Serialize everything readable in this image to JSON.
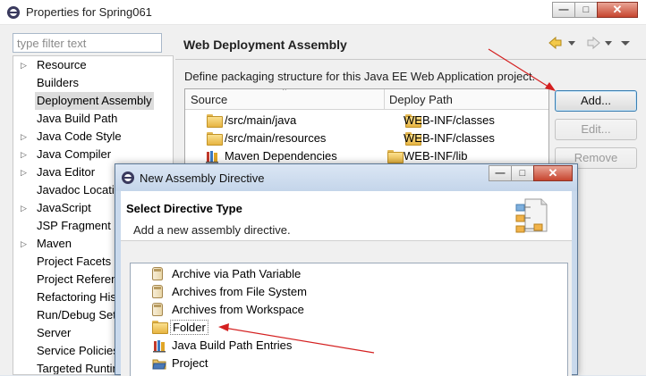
{
  "window": {
    "title": "Properties for Spring061",
    "minimize": "—",
    "maximize": "□",
    "close": "✕"
  },
  "filter": {
    "placeholder": "type filter text"
  },
  "nav": {
    "items": [
      {
        "label": "Resource",
        "expandable": true,
        "selected": false
      },
      {
        "label": "Builders",
        "expandable": false,
        "selected": false
      },
      {
        "label": "Deployment Assembly",
        "expandable": false,
        "selected": true
      },
      {
        "label": "Java Build Path",
        "expandable": false,
        "selected": false
      },
      {
        "label": "Java Code Style",
        "expandable": true,
        "selected": false
      },
      {
        "label": "Java Compiler",
        "expandable": true,
        "selected": false
      },
      {
        "label": "Java Editor",
        "expandable": true,
        "selected": false
      },
      {
        "label": "Javadoc Location",
        "expandable": false,
        "selected": false
      },
      {
        "label": "JavaScript",
        "expandable": true,
        "selected": false
      },
      {
        "label": "JSP Fragment",
        "expandable": false,
        "selected": false
      },
      {
        "label": "Maven",
        "expandable": true,
        "selected": false
      },
      {
        "label": "Project Facets",
        "expandable": false,
        "selected": false
      },
      {
        "label": "Project References",
        "expandable": false,
        "selected": false
      },
      {
        "label": "Refactoring History",
        "expandable": false,
        "selected": false
      },
      {
        "label": "Run/Debug Settings",
        "expandable": false,
        "selected": false
      },
      {
        "label": "Server",
        "expandable": false,
        "selected": false
      },
      {
        "label": "Service Policies",
        "expandable": false,
        "selected": false
      },
      {
        "label": "Targeted Runtimes",
        "expandable": false,
        "selected": false
      }
    ]
  },
  "page": {
    "title": "Web Deployment Assembly",
    "description": "Define packaging structure for this Java EE Web Application project."
  },
  "table": {
    "columns": [
      "Source",
      "Deploy Path"
    ],
    "rows": [
      {
        "source": "/src/main/java",
        "deploy": "WEB-INF/classes",
        "icon": "folder-icon"
      },
      {
        "source": "/src/main/resources",
        "deploy": "WEB-INF/classes",
        "icon": "folder-icon"
      },
      {
        "source": "Maven Dependencies",
        "deploy": "WEB-INF/lib",
        "icon": "library-icon"
      }
    ]
  },
  "buttons": {
    "add": "Add...",
    "edit": "Edit...",
    "remove": "Remove"
  },
  "dialog": {
    "title": "New Assembly Directive",
    "heading": "Select Directive Type",
    "subtitle": "Add a new assembly directive.",
    "items": [
      {
        "label": "Archive via Path Variable",
        "icon": "jar-icon"
      },
      {
        "label": "Archives from File System",
        "icon": "jar-icon"
      },
      {
        "label": "Archives from Workspace",
        "icon": "jar-icon"
      },
      {
        "label": "Folder",
        "icon": "folder-icon",
        "selected": true
      },
      {
        "label": "Java Build Path Entries",
        "icon": "library-icon"
      },
      {
        "label": "Project",
        "icon": "project-icon"
      }
    ]
  },
  "colors": {
    "annotation": "#d42020",
    "selection": "#dcdcdc",
    "accent": "#3c7fb1"
  }
}
